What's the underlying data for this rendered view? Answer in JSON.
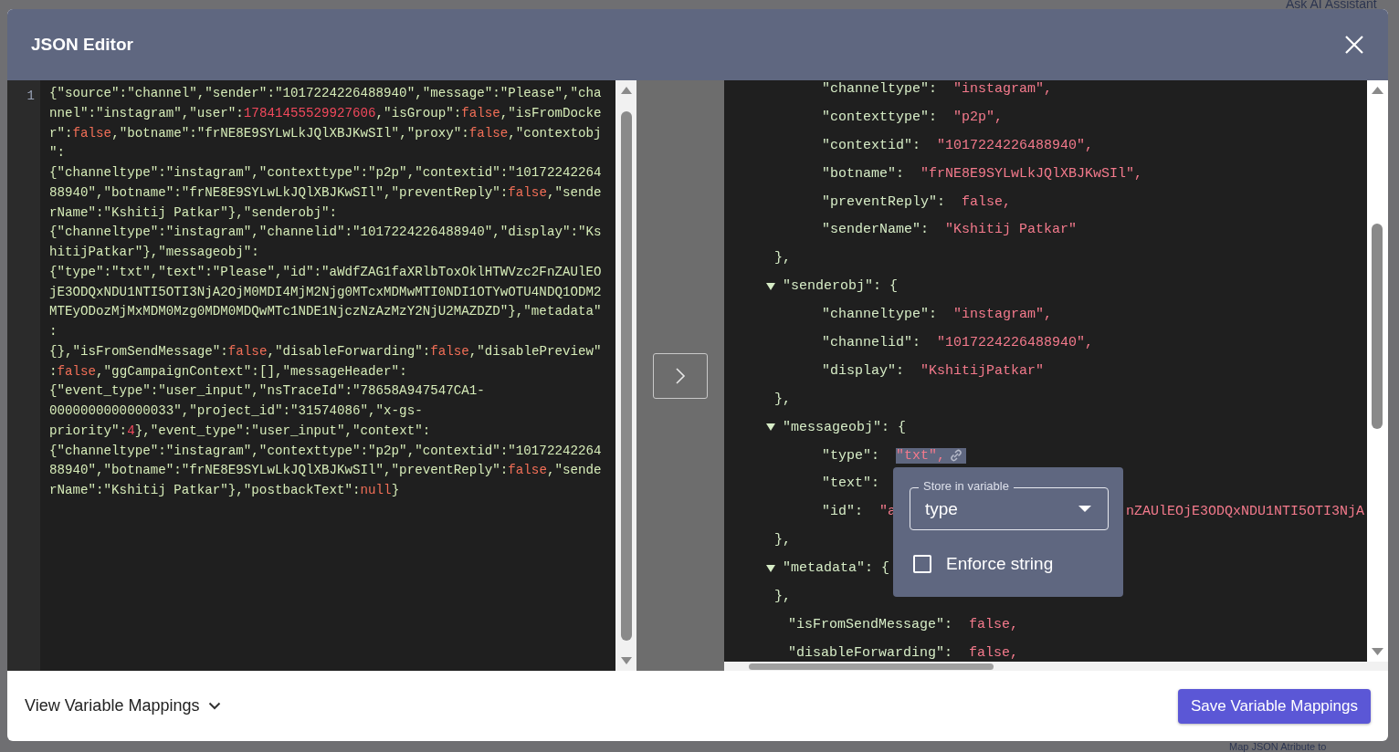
{
  "backdrop": {
    "top_text": "Ask AI Assistant",
    "bottom_text": "Map JSON Atribute to"
  },
  "window": {
    "title": "JSON Editor"
  },
  "raw_editor": {
    "line_number": "1",
    "lines": [
      [
        {
          "text": "{\"source\":\"channel\",\"sender\":\"1017224226488940\",\"message\":\"Please\",\"cha",
          "kind": "plain"
        }
      ],
      [
        {
          "text": "nnel\":\"instagram\",\"user\":",
          "kind": "plain"
        },
        {
          "text": "17841455529927606",
          "kind": "number"
        },
        {
          "text": ",\"isGroup\":",
          "kind": "plain"
        },
        {
          "text": "false",
          "kind": "literal"
        },
        {
          "text": ",\"isFromDocke",
          "kind": "plain"
        }
      ],
      [
        {
          "text": "r\":",
          "kind": "plain"
        },
        {
          "text": "false",
          "kind": "literal"
        },
        {
          "text": ",\"botname\":\"frNE8E9SYLwLkJQlXBJKwSIl\",\"proxy\":",
          "kind": "plain"
        },
        {
          "text": "false",
          "kind": "literal"
        },
        {
          "text": ",\"contextobj",
          "kind": "plain"
        }
      ],
      [
        {
          "text": "\":",
          "kind": "plain"
        }
      ],
      [
        {
          "text": "{\"channeltype\":\"instagram\",\"contexttype\":\"p2p\",\"contextid\":\"10172242264",
          "kind": "plain"
        }
      ],
      [
        {
          "text": "88940\",\"botname\":\"frNE8E9SYLwLkJQlXBJKwSIl\",\"preventReply\":",
          "kind": "plain"
        },
        {
          "text": "false",
          "kind": "literal"
        },
        {
          "text": ",\"sende",
          "kind": "plain"
        }
      ],
      [
        {
          "text": "rName\":\"Kshitij Patkar\"},\"senderobj\":",
          "kind": "plain"
        }
      ],
      [
        {
          "text": "{\"channeltype\":\"instagram\",\"channelid\":\"1017224226488940\",\"display\":\"Ks",
          "kind": "plain"
        }
      ],
      [
        {
          "text": "hitijPatkar\"},\"messageobj\":",
          "kind": "plain"
        }
      ],
      [
        {
          "text": "{\"type\":\"txt\",\"text\":\"Please\",\"id\":\"aWdfZAG1faXRlbToxOklHTWVzc2FnZAUlEO",
          "kind": "plain"
        }
      ],
      [
        {
          "text": "jE3ODQxNDU1NTI5OTI3NjA2OjM0MDI4MjM2Njg0MTcxMDMwMTI0NDI1OTYwOTU4NDQ1ODM2",
          "kind": "plain"
        }
      ],
      [
        {
          "text": "MTEyODozMjMxMDM0Mzg0MDM0MDQwMTc1NDE1NjczNzAzMzY2NjU2MAZDZD\"},\"metadata\"",
          "kind": "plain"
        }
      ],
      [
        {
          "text": ":",
          "kind": "plain"
        }
      ],
      [
        {
          "text": "{},\"isFromSendMessage\":",
          "kind": "plain"
        },
        {
          "text": "false",
          "kind": "literal"
        },
        {
          "text": ",\"disableForwarding\":",
          "kind": "plain"
        },
        {
          "text": "false",
          "kind": "literal"
        },
        {
          "text": ",\"disablePreview\"",
          "kind": "plain"
        }
      ],
      [
        {
          "text": ":",
          "kind": "plain"
        },
        {
          "text": "false",
          "kind": "literal"
        },
        {
          "text": ",\"ggCampaignContext\":[],\"messageHeader\":",
          "kind": "plain"
        }
      ],
      [
        {
          "text": "{\"event_type\":\"user_input\",\"nsTraceId\":\"78658A947547CA1-",
          "kind": "plain"
        }
      ],
      [
        {
          "text": "0000000000000033\",\"project_id\":\"31574086\",\"x-gs-",
          "kind": "plain"
        }
      ],
      [
        {
          "text": "priority\":",
          "kind": "plain"
        },
        {
          "text": "4",
          "kind": "number"
        },
        {
          "text": "},\"event_type\":\"user_input\",\"context\":",
          "kind": "plain"
        }
      ],
      [
        {
          "text": "{\"channeltype\":\"instagram\",\"contexttype\":\"p2p\",\"contextid\":\"10172242264",
          "kind": "plain"
        }
      ],
      [
        {
          "text": "88940\",\"botname\":\"frNE8E9SYLwLkJQlXBJKwSIl\",\"preventReply\":",
          "kind": "plain"
        },
        {
          "text": "false",
          "kind": "literal"
        },
        {
          "text": ",\"sende",
          "kind": "plain"
        }
      ],
      [
        {
          "text": "rName\":\"Kshitij Patkar\"},\"postbackText\":",
          "kind": "plain"
        },
        {
          "text": "null",
          "kind": "literal"
        },
        {
          "text": "}",
          "kind": "plain"
        }
      ]
    ]
  },
  "tree": [
    {
      "kind": "tail",
      "children": [
        {
          "kind": "pair",
          "key": "\"channeltype\":",
          "value": "\"instagram\","
        },
        {
          "kind": "pair",
          "key": "\"contexttype\":",
          "value": "\"p2p\","
        },
        {
          "kind": "pair",
          "key": "\"contextid\":",
          "value": "\"1017224226488940\","
        },
        {
          "kind": "pair",
          "key": "\"botname\":",
          "value": "\"frNE8E9SYLwLkJQlXBJKwSIl\","
        },
        {
          "kind": "pair",
          "key": "\"preventReply\":",
          "value": "false,"
        },
        {
          "kind": "pair",
          "key": "\"senderName\":",
          "value": "\"Kshitij Patkar\""
        }
      ],
      "close": "},"
    },
    {
      "kind": "object",
      "key": "\"senderobj\":",
      "open": "{",
      "expanded": true,
      "children": [
        {
          "kind": "pair",
          "key": "\"channeltype\":",
          "value": "\"instagram\","
        },
        {
          "kind": "pair",
          "key": "\"channelid\":",
          "value": "\"1017224226488940\","
        },
        {
          "kind": "pair",
          "key": "\"display\":",
          "value": "\"KshitijPatkar\""
        }
      ],
      "close": "},"
    },
    {
      "kind": "object",
      "key": "\"messageobj\":",
      "open": "{",
      "expanded": true,
      "children": [
        {
          "kind": "pair",
          "key": "\"type\":",
          "value": "\"txt\",",
          "highlighted": true
        },
        {
          "kind": "pair",
          "key": "\"text\":"
        },
        {
          "kind": "pair",
          "key": "\"id\":",
          "value": "\"a",
          "value_tail": "nZAUlEOjE3ODQxNDU1NTI5OTI3NjA"
        }
      ],
      "close": "},"
    },
    {
      "kind": "object",
      "key": "\"metadata\":",
      "open": "{",
      "expanded": true,
      "close": "},"
    },
    {
      "kind": "pair",
      "key": "\"isFromSendMessage\":",
      "value": "false,"
    },
    {
      "kind": "pair",
      "key": "\"disableForwarding\":",
      "value": "false,"
    }
  ],
  "popup": {
    "field_label": "Store in variable",
    "value": "type",
    "checkbox": {
      "label": "Enforce string",
      "checked": false
    }
  },
  "footer": {
    "mappings_toggle": "View Variable Mappings",
    "save_button": "Save Variable Mappings"
  }
}
